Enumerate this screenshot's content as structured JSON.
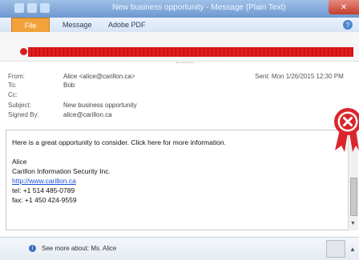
{
  "window": {
    "title": "New business opportunity - Message (Plain Text)",
    "close_glyph": "✕"
  },
  "ribbon": {
    "file_label": "File",
    "tabs": [
      "Message",
      "Adobe PDF"
    ],
    "help_glyph": "?"
  },
  "headers": {
    "from_label": "From:",
    "from_value": "Alice <alice@carillon.ca>",
    "to_label": "To:",
    "to_value": "Bob",
    "cc_label": "Cc:",
    "subject_label": "Subject:",
    "subject_value": "New business opportunity",
    "signed_label": "Signed By:",
    "signed_value": "alice@carillon.ca",
    "sent": "Sent: Mon 1/26/2015 12:30 PM"
  },
  "body": {
    "lines": [
      "Here is a great opportunity to consider. Click here for more information.",
      "Alice",
      "Carillon Information Security Inc."
    ],
    "link": "http://www.carillon.ca",
    "tel": "tel: +1 514 485-0789",
    "fax": "fax: +1 450 424-9559"
  },
  "people_pane": {
    "text": "See more about: Ms. Alice",
    "info_glyph": "i",
    "expand_glyph": "▲"
  },
  "colors": {
    "alert_red": "#e01c1c",
    "ribbon_file": "#f2a23b",
    "link_blue": "#1a4fd8"
  },
  "icons": [
    "info-icon",
    "certificate-warning-icon",
    "close-icon",
    "help-icon"
  ]
}
